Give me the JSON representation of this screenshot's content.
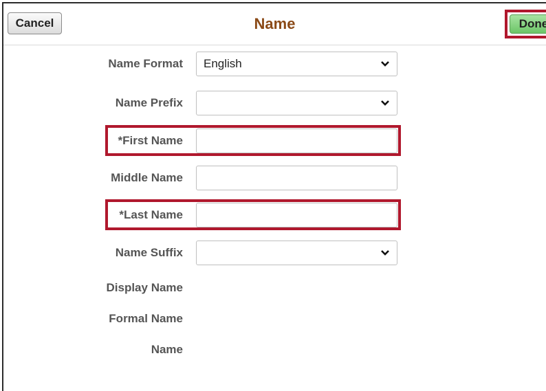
{
  "header": {
    "title": "Name",
    "cancel_label": "Cancel",
    "done_label": "Done"
  },
  "form": {
    "name_format": {
      "label": "Name Format",
      "value": "English"
    },
    "name_prefix": {
      "label": "Name Prefix",
      "value": ""
    },
    "first_name": {
      "label": "*First Name",
      "value": ""
    },
    "middle_name": {
      "label": "Middle Name",
      "value": ""
    },
    "last_name": {
      "label": "*Last Name",
      "value": ""
    },
    "name_suffix": {
      "label": "Name Suffix",
      "value": ""
    },
    "display_name": {
      "label": "Display Name"
    },
    "formal_name": {
      "label": "Formal Name"
    },
    "name": {
      "label": "Name"
    }
  },
  "colors": {
    "title": "#8b4a17",
    "highlight": "#b0182d",
    "done_button": "#8dd688"
  }
}
